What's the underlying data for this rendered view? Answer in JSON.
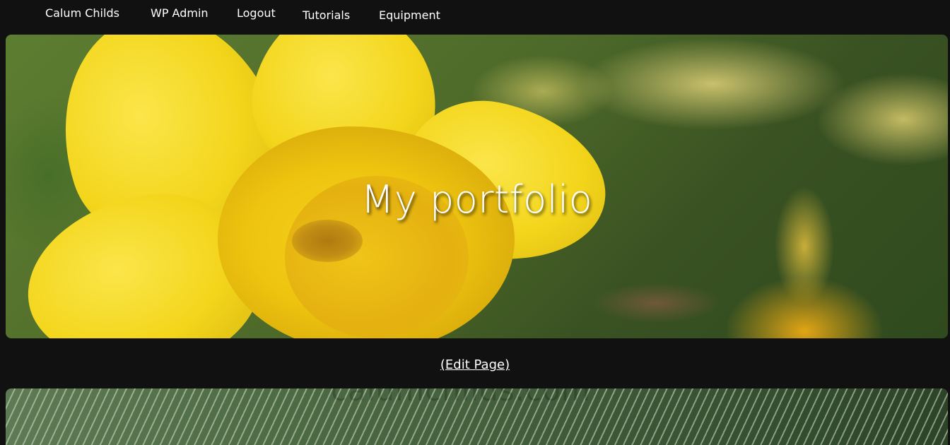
{
  "nav": {
    "items": [
      {
        "label": "Calum Childs"
      },
      {
        "label": "WP Admin"
      },
      {
        "label": "Logout"
      },
      {
        "label": "Tutorials"
      },
      {
        "label": "Equipment"
      }
    ]
  },
  "hero": {
    "title": "My portfolio"
  },
  "edit": {
    "label": "(Edit Page)"
  },
  "gallery": {
    "watermark": "calumchilds.com"
  }
}
